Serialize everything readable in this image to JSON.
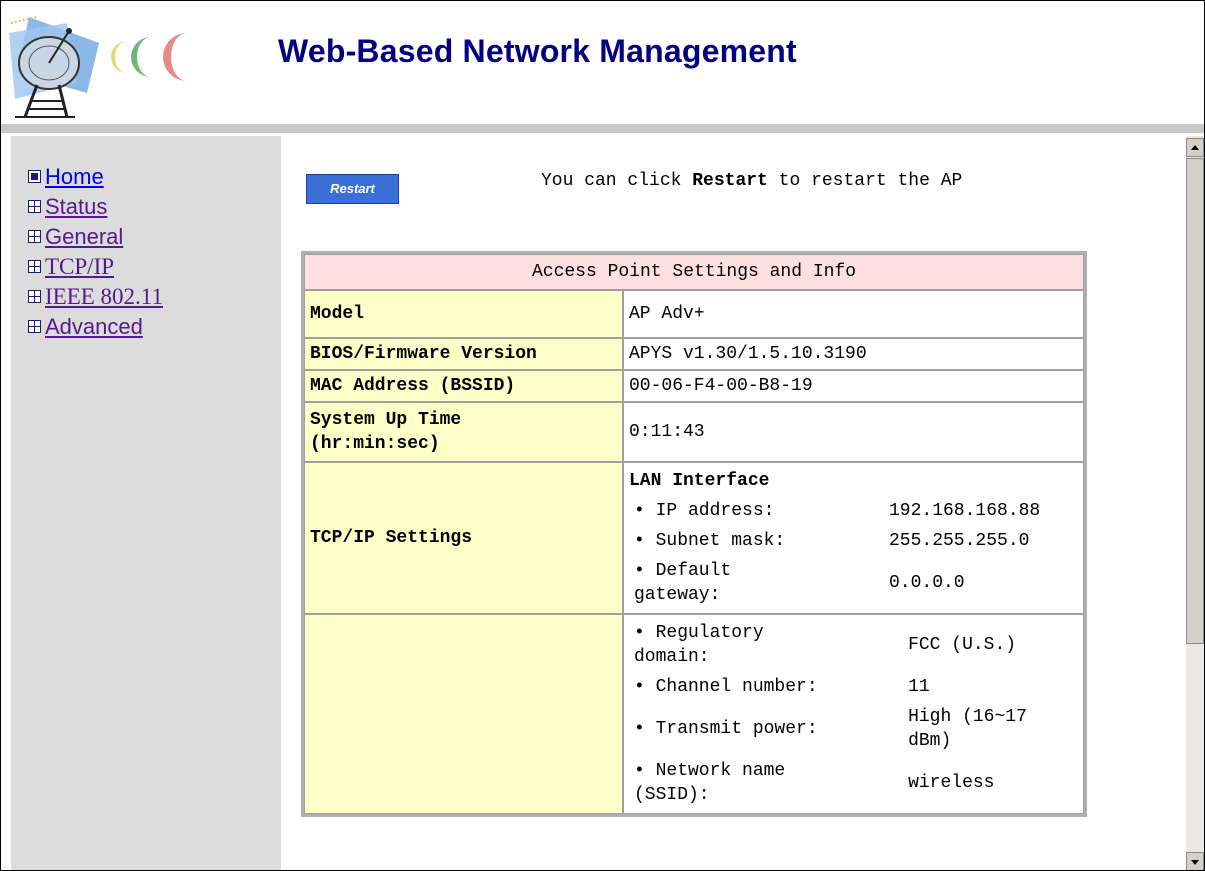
{
  "header": {
    "title": "Web-Based Network Management"
  },
  "sidebar": {
    "items": [
      {
        "label": "Home",
        "expander": "dot"
      },
      {
        "label": "Status",
        "expander": "plus"
      },
      {
        "label": "General",
        "expander": "plus"
      },
      {
        "label": "TCP/IP",
        "expander": "plus"
      },
      {
        "label": "IEEE 802.11",
        "expander": "plus"
      },
      {
        "label": "Advanced",
        "expander": "plus"
      }
    ]
  },
  "main": {
    "restart_button": "Restart",
    "hint_pre": "You can click ",
    "hint_bold": "Restart",
    "hint_post": " to restart the AP",
    "table_title": "Access Point Settings and Info",
    "rows": {
      "model": {
        "label": "Model",
        "value": "AP Adv+"
      },
      "firmware": {
        "label": "BIOS/Firmware Version",
        "value": "APYS v1.30/1.5.10.3190"
      },
      "mac": {
        "label": "MAC Address (BSSID)",
        "value": "00-06-F4-00-B8-19"
      },
      "uptime": {
        "label_line1": "System Up Time",
        "label_line2": "(hr:min:sec)",
        "value": "0:11:43"
      },
      "tcpip": {
        "label": "TCP/IP Settings",
        "heading": "LAN Interface",
        "items": [
          {
            "k": "• IP address:",
            "v": "192.168.168.88"
          },
          {
            "k": "• Subnet mask:",
            "v": "255.255.255.0"
          },
          {
            "k": "• Default gateway:",
            "v": "0.0.0.0"
          }
        ]
      },
      "wireless": {
        "label": "",
        "items": [
          {
            "k": "• Regulatory domain:",
            "v": "FCC (U.S.)"
          },
          {
            "k": "• Channel number:",
            "v": "11"
          },
          {
            "k": "• Transmit power:",
            "v": "High (16~17 dBm)"
          },
          {
            "k": "• Network name (SSID):",
            "v": "wireless"
          }
        ]
      }
    }
  },
  "colors": {
    "title": "#000080",
    "sidebar_bg": "#dcdcdc",
    "table_title_bg": "#ffe0e0",
    "label_bg": "#ffffc8",
    "button_bg": "#3a6fd8"
  }
}
